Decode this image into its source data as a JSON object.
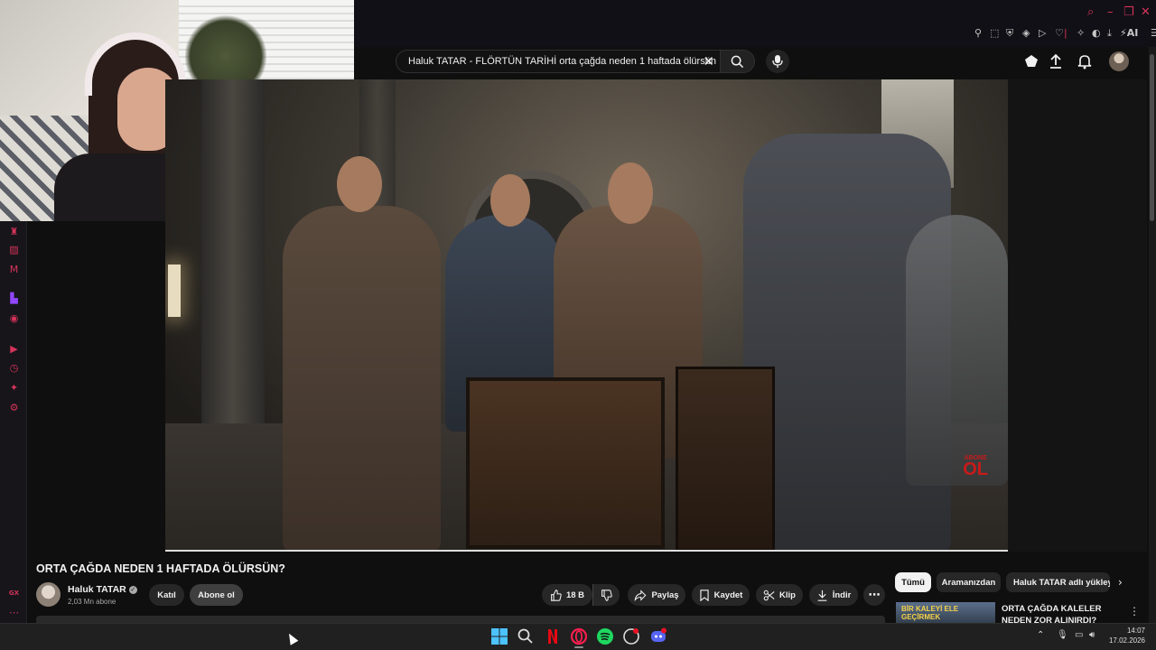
{
  "browser": {
    "window_controls": [
      "search-icon",
      "minimize-icon",
      "restore-icon",
      "close-icon"
    ],
    "ai_label": "AI"
  },
  "search": {
    "query": "Haluk TATAR - FLÖRTÜN TARİHİ orta çağda neden 1 haftada ölürsün"
  },
  "video": {
    "title": "ORTA ÇAĞDA NEDEN 1 HAFTADA ÖLÜRSÜN?",
    "watermark_top": "ABONE",
    "watermark_main": "OL"
  },
  "channel": {
    "name": "Haluk TATAR",
    "subscribers": "2,03 Mn abone",
    "join_label": "Katıl",
    "subscribe_label": "Abone ol"
  },
  "actions": {
    "likes": "18 B",
    "share": "Paylaş",
    "save": "Kaydet",
    "clip": "Klip",
    "download": "İndir"
  },
  "chips": [
    "Tümü",
    "Aramanızdan",
    "Haluk TATAR adlı yükley"
  ],
  "recommendation": {
    "thumb_text": "BİR KALEYİ ELE GEÇİRMEK",
    "title": "ORTA ÇAĞDA KALELER NEDEN ZOR ALINIRDI?"
  },
  "taskbar": {
    "time": "14:07",
    "date": "17.02.2026"
  },
  "sidebar_bottom_label": "GX"
}
